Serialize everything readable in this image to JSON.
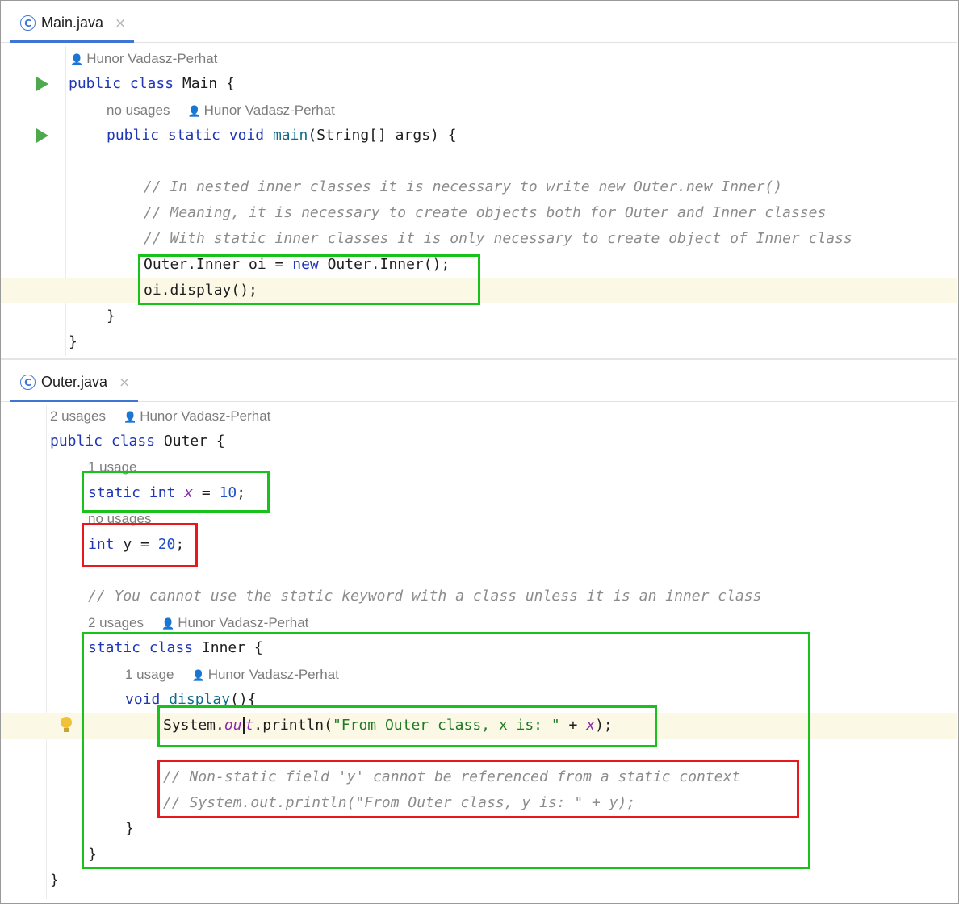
{
  "colors": {
    "green_box": "#19c21a",
    "red_box": "#e8191c",
    "tab_accent": "#3f76d6",
    "current_line": "#fcf8e6"
  },
  "icons": {
    "class_file": "class-c-icon",
    "close": "close-icon",
    "run": "run-icon",
    "author": "person-icon",
    "intention": "lightbulb-icon"
  },
  "main_pane": {
    "tab": {
      "icon_glyph": "C",
      "label": "Main.java",
      "close_glyph": "×"
    },
    "hints": {
      "class_author": "Hunor Vadasz-Perhat",
      "method_usages": "no usages",
      "method_author": "Hunor Vadasz-Perhat"
    },
    "code": {
      "class_public": "public",
      "class_class": "class",
      "class_rest": " Main {",
      "m_public": "public",
      "m_static": "static",
      "m_void": "void",
      "m_name": "main",
      "m_rest": "(String[] args) {",
      "comment1": "// In nested inner classes it is necessary to write new Outer.new Inner()",
      "comment2": "// Meaning, it is necessary to create objects both for Outer and Inner classes",
      "comment3": "// With static inner classes it is only necessary to create object of Inner class",
      "l1_a": "Outer.Inner oi = ",
      "l1_new": "new",
      "l1_b": " Outer.Inner();",
      "l2": "oi.display();",
      "close_method": "}",
      "close_class": "}"
    }
  },
  "outer_pane": {
    "tab": {
      "icon_glyph": "C",
      "label": "Outer.java",
      "close_glyph": "×"
    },
    "hints": {
      "class_usages": "2 usages",
      "class_author": "Hunor Vadasz-Perhat",
      "x_usages": "1 usage",
      "y_usages": "no usages",
      "inner_usages": "2 usages",
      "inner_author": "Hunor Vadasz-Perhat",
      "display_usages": "1 usage",
      "display_author": "Hunor Vadasz-Perhat"
    },
    "code": {
      "c_public": "public",
      "c_class": "class",
      "c_rest": " Outer {",
      "x_static": "static",
      "x_int": "int",
      "x_name": "x",
      "x_eq": " = ",
      "x_val": "10",
      "x_end": ";",
      "y_int": "int",
      "y_rest": " y = ",
      "y_val": "20",
      "y_end": ";",
      "comment_static": "// You cannot use the static keyword with a class unless it is an inner class",
      "i_static": "static",
      "i_class": "class",
      "i_rest": " Inner {",
      "d_void": "void",
      "d_name": "display",
      "d_rest": "(){",
      "p_a": "System.",
      "p_out1": "ou",
      "p_out2": "t",
      "p_b": ".println(",
      "p_str": "\"From Outer class, x is: \"",
      "p_plus": " + ",
      "p_x": "x",
      "p_end": ");",
      "comment_ns1": "// Non-static field 'y' cannot be referenced from a static context",
      "comment_ns2": "// System.out.println(\"From Outer class, y is: \" + y);",
      "close_method": "}",
      "close_inner": "}",
      "close_class": "}"
    }
  }
}
